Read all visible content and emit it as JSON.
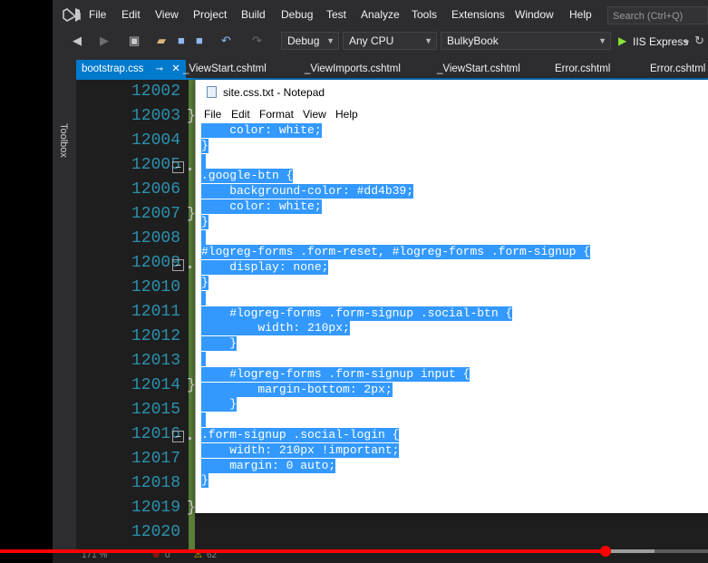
{
  "menubar": {
    "items": [
      "File",
      "Edit",
      "View",
      "Project",
      "Build",
      "Debug",
      "Test",
      "Analyze",
      "Tools",
      "Extensions",
      "Window",
      "Help"
    ],
    "search_placeholder": "Search (Ctrl+Q)"
  },
  "toolbar": {
    "configuration": "Debug",
    "platform": "Any CPU",
    "startup_project": "BulkyBook",
    "run_target": "IIS Express"
  },
  "toolbox": {
    "label": "Toolbox"
  },
  "tabs": [
    {
      "label": "bootstrap.css",
      "active": true
    },
    {
      "label": "_ViewStart.cshtml"
    },
    {
      "label": "_ViewImports.cshtml"
    },
    {
      "label": "_ViewStart.cshtml"
    },
    {
      "label": "Error.cshtml"
    },
    {
      "label": "Error.cshtml"
    }
  ],
  "editor": {
    "line_numbers": [
      "12002",
      "12003",
      "12004",
      "12005",
      "12006",
      "12007",
      "12008",
      "12009",
      "12010",
      "12011",
      "12012",
      "12013",
      "12014",
      "12015",
      "12016",
      "12017",
      "12018",
      "12019",
      "12020"
    ]
  },
  "notepad": {
    "title": "site.css.txt - Notepad",
    "menu": [
      "File",
      "Edit",
      "Format",
      "View",
      "Help"
    ],
    "lines": [
      "    color: white;",
      "}",
      "",
      ".google-btn {",
      "    background-color: #dd4b39;",
      "    color: white;",
      "}",
      "",
      "#logreg-forms .form-reset, #logreg-forms .form-signup {",
      "    display: none;",
      "}",
      "",
      "    #logreg-forms .form-signup .social-btn {",
      "        width: 210px;",
      "    }",
      "",
      "    #logreg-forms .form-signup input {",
      "        margin-bottom: 2px;",
      "    }",
      "",
      ".form-signup .social-login {",
      "    width: 210px !important;",
      "    margin: 0 auto;",
      "}"
    ]
  },
  "statusbar": {
    "zoom": "171 %",
    "errors": "0",
    "warnings": "62"
  },
  "video_progress": {
    "played_fraction": 0.855,
    "buffered_fraction": 0.925
  },
  "colors": {
    "ide_bg": "#2d2d30",
    "editor_bg": "#1e1e1e",
    "line_number": "#2b91af",
    "accent": "#007acc",
    "selection": "#3399ff",
    "progress": "#ff0000"
  }
}
